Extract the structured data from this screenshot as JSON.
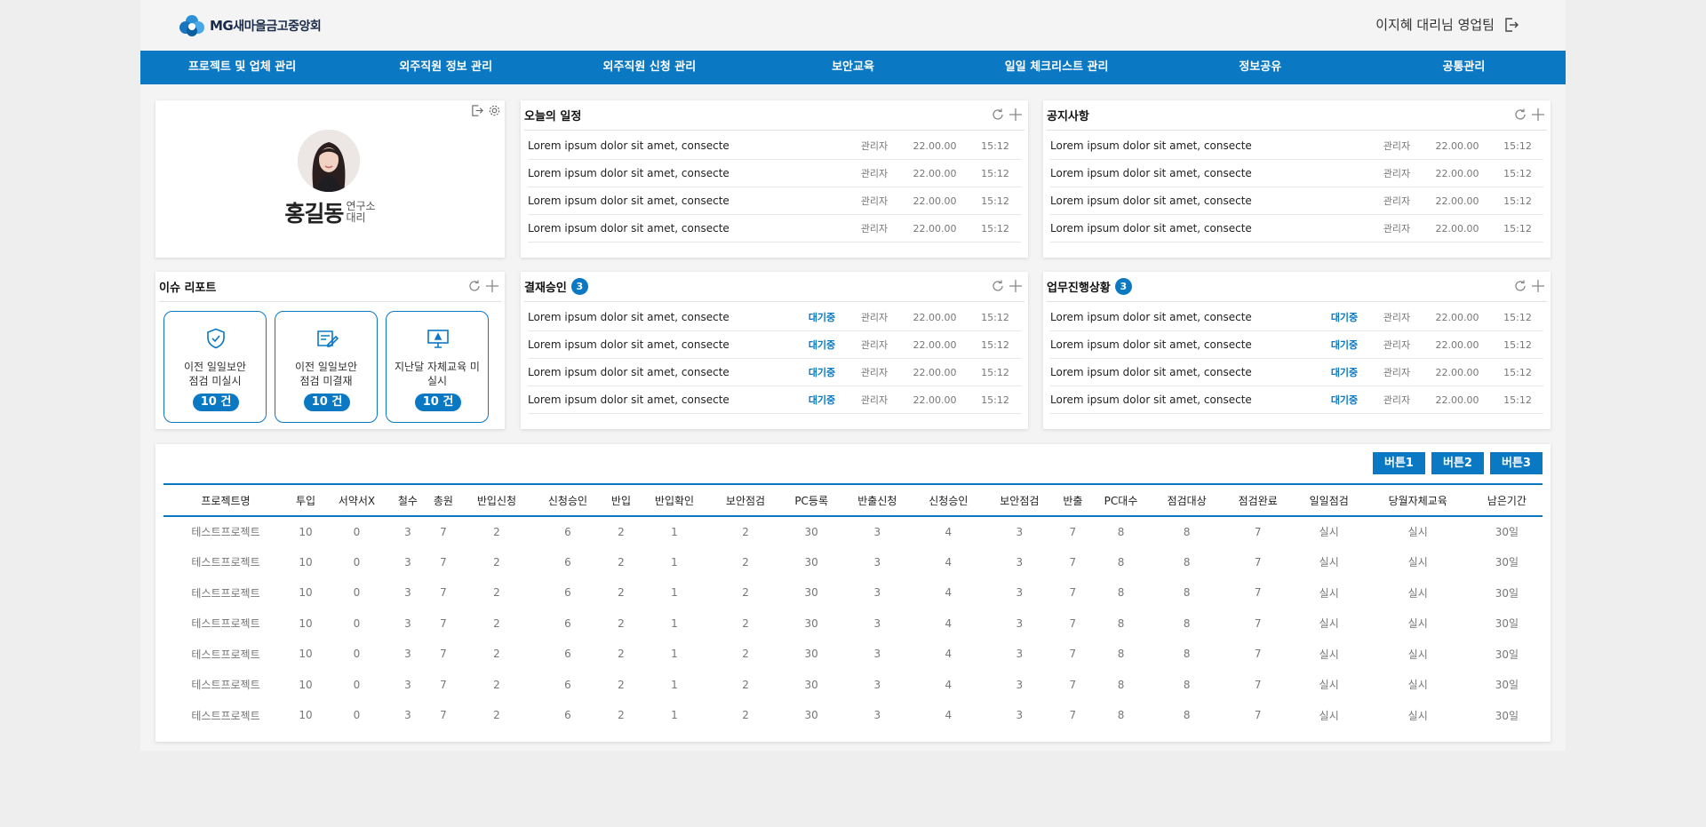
{
  "header": {
    "logo_mg": "MG",
    "logo_text": "새마을금고중앙회",
    "user_text": "이지혜 대리님  영업팀"
  },
  "nav": [
    "프로젝트 및 업체 관리",
    "외주직원 정보 관리",
    "외주직원 신청 관리",
    "보안교육",
    "일일 체크리스트 관리",
    "정보공유",
    "공통관리"
  ],
  "profile": {
    "name": "홍길동",
    "dept": "연구소",
    "rank": "대리"
  },
  "schedule": {
    "title": "오늘의 일정",
    "rows": [
      {
        "title": "Lorem ipsum dolor sit amet, consecte",
        "author": "관리자",
        "date": "22.00.00",
        "time": "15:12"
      },
      {
        "title": "Lorem ipsum dolor sit amet, consecte",
        "author": "관리자",
        "date": "22.00.00",
        "time": "15:12"
      },
      {
        "title": "Lorem ipsum dolor sit amet, consecte",
        "author": "관리자",
        "date": "22.00.00",
        "time": "15:12"
      },
      {
        "title": "Lorem ipsum dolor sit amet, consecte",
        "author": "관리자",
        "date": "22.00.00",
        "time": "15:12"
      }
    ]
  },
  "notice": {
    "title": "공지사항",
    "rows": [
      {
        "title": "Lorem ipsum dolor sit amet, consecte",
        "author": "관리자",
        "date": "22.00.00",
        "time": "15:12"
      },
      {
        "title": "Lorem ipsum dolor sit amet, consecte",
        "author": "관리자",
        "date": "22.00.00",
        "time": "15:12"
      },
      {
        "title": "Lorem ipsum dolor sit amet, consecte",
        "author": "관리자",
        "date": "22.00.00",
        "time": "15:12"
      },
      {
        "title": "Lorem ipsum dolor sit amet, consecte",
        "author": "관리자",
        "date": "22.00.00",
        "time": "15:12"
      }
    ]
  },
  "issue": {
    "title": "이슈 리포트",
    "cards": [
      {
        "label": "이전 일일보안\n점검 미실시",
        "count": "10 건",
        "icon": "shield-check-icon"
      },
      {
        "label": "이전 일일보안\n점검 미결재",
        "count": "10 건",
        "icon": "document-edit-icon"
      },
      {
        "label": "지난달 자체교육 미\n실시",
        "count": "10 건",
        "icon": "monitor-icon"
      }
    ]
  },
  "approval": {
    "title": "결재승인",
    "badge": "3",
    "rows": [
      {
        "title": "Lorem ipsum dolor sit amet, consecte",
        "status": "대기중",
        "author": "관리자",
        "date": "22.00.00",
        "time": "15:12"
      },
      {
        "title": "Lorem ipsum dolor sit amet, consecte",
        "status": "대기중",
        "author": "관리자",
        "date": "22.00.00",
        "time": "15:12"
      },
      {
        "title": "Lorem ipsum dolor sit amet, consecte",
        "status": "대기중",
        "author": "관리자",
        "date": "22.00.00",
        "time": "15:12"
      },
      {
        "title": "Lorem ipsum dolor sit amet, consecte",
        "status": "대기중",
        "author": "관리자",
        "date": "22.00.00",
        "time": "15:12"
      }
    ]
  },
  "progress": {
    "title": "업무진행상황",
    "badge": "3",
    "rows": [
      {
        "title": "Lorem ipsum dolor sit amet, consecte",
        "status": "대기중",
        "author": "관리자",
        "date": "22.00.00",
        "time": "15:12"
      },
      {
        "title": "Lorem ipsum dolor sit amet, consecte",
        "status": "대기중",
        "author": "관리자",
        "date": "22.00.00",
        "time": "15:12"
      },
      {
        "title": "Lorem ipsum dolor sit amet, consecte",
        "status": "대기중",
        "author": "관리자",
        "date": "22.00.00",
        "time": "15:12"
      },
      {
        "title": "Lorem ipsum dolor sit amet, consecte",
        "status": "대기중",
        "author": "관리자",
        "date": "22.00.00",
        "time": "15:12"
      }
    ]
  },
  "table": {
    "buttons": [
      "버튼1",
      "버튼2",
      "버튼3"
    ],
    "headers": [
      "프로젝트명",
      "투입",
      "서약서X",
      "철수",
      "총원",
      "반입신청",
      "신청승인",
      "반입",
      "반입확인",
      "보안점검",
      "PC등록",
      "반출신청",
      "신청승인",
      "보안점검",
      "반출",
      "PC대수",
      "점검대상",
      "점검완료",
      "일일점검",
      "당월자체교육",
      "남은기간"
    ],
    "rows": [
      [
        "테스트프로젝트",
        "10",
        "0",
        "3",
        "7",
        "2",
        "6",
        "2",
        "1",
        "2",
        "30",
        "3",
        "4",
        "3",
        "7",
        "8",
        "8",
        "7",
        "실시",
        "실시",
        "30일"
      ],
      [
        "테스트프로젝트",
        "10",
        "0",
        "3",
        "7",
        "2",
        "6",
        "2",
        "1",
        "2",
        "30",
        "3",
        "4",
        "3",
        "7",
        "8",
        "8",
        "7",
        "실시",
        "실시",
        "30일"
      ],
      [
        "테스트프로젝트",
        "10",
        "0",
        "3",
        "7",
        "2",
        "6",
        "2",
        "1",
        "2",
        "30",
        "3",
        "4",
        "3",
        "7",
        "8",
        "8",
        "7",
        "실시",
        "실시",
        "30일"
      ],
      [
        "테스트프로젝트",
        "10",
        "0",
        "3",
        "7",
        "2",
        "6",
        "2",
        "1",
        "2",
        "30",
        "3",
        "4",
        "3",
        "7",
        "8",
        "8",
        "7",
        "실시",
        "실시",
        "30일"
      ],
      [
        "테스트프로젝트",
        "10",
        "0",
        "3",
        "7",
        "2",
        "6",
        "2",
        "1",
        "2",
        "30",
        "3",
        "4",
        "3",
        "7",
        "8",
        "8",
        "7",
        "실시",
        "실시",
        "30일"
      ],
      [
        "테스트프로젝트",
        "10",
        "0",
        "3",
        "7",
        "2",
        "6",
        "2",
        "1",
        "2",
        "30",
        "3",
        "4",
        "3",
        "7",
        "8",
        "8",
        "7",
        "실시",
        "실시",
        "30일"
      ],
      [
        "테스트프로젝트",
        "10",
        "0",
        "3",
        "7",
        "2",
        "6",
        "2",
        "1",
        "2",
        "30",
        "3",
        "4",
        "3",
        "7",
        "8",
        "8",
        "7",
        "실시",
        "실시",
        "30일"
      ]
    ]
  },
  "colors": {
    "brand": "#0b78c4",
    "background": "#f4f4f4"
  }
}
